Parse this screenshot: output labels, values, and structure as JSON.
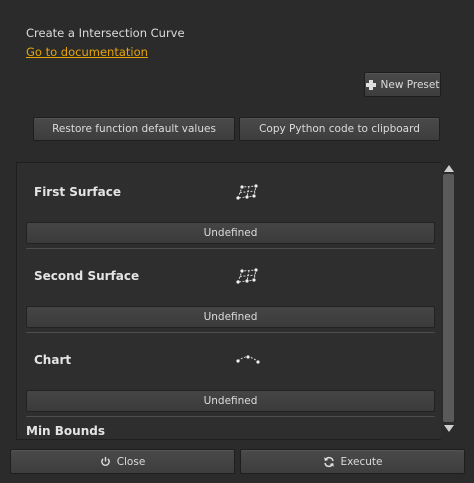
{
  "dialog": {
    "title": "Create a Intersection Curve",
    "doc_link": "Go to documentation"
  },
  "toolbar": {
    "new_preset_label": "New Preset",
    "restore_label": "Restore function default values",
    "copy_label": "Copy Python code to clipboard"
  },
  "sections": [
    {
      "label": "First Surface",
      "icon": "surface-icon",
      "value": "Undefined"
    },
    {
      "label": "Second Surface",
      "icon": "surface-icon",
      "value": "Undefined"
    },
    {
      "label": "Chart",
      "icon": "chart-icon",
      "value": "Undefined"
    }
  ],
  "min_bounds_label": "Min Bounds",
  "footer": {
    "close_label": "Close",
    "execute_label": "Execute"
  },
  "colors": {
    "background": "#2b2b2b",
    "link": "#e6a40a",
    "text": "#dcdcdc"
  }
}
